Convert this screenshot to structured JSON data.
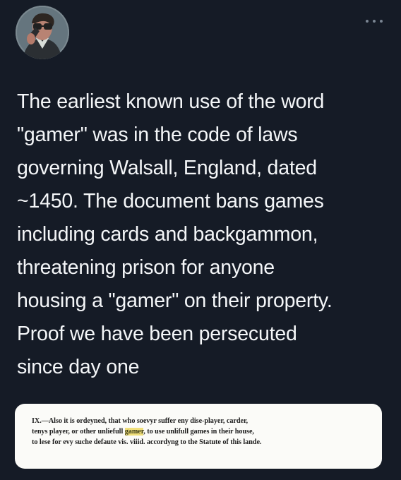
{
  "post": {
    "text": "The earliest known use of the word\n\"gamer\" was in the code of laws\ngoverning Walsall, England, dated\n~1450. The document bans games\nincluding cards and backgammon,\nthreatening prison for anyone\nhousing a \"gamer\" on their property.\nProof we have been persecuted\nsince day one",
    "more_icon": "more-horizontal-icon",
    "avatar_icon": "avatar-photo"
  },
  "document_excerpt": {
    "before_highlight": "IX.—Also it is ordeyned, that who soevyr suffer eny dise-player, carder,\ntenys player, or other unliefull ",
    "highlighted_word": "gamer",
    "after_highlight": ", to use unlifull games in their house,\nto lese for evy suche defaute vis. viiid. accordyng to the Statute of this lande.",
    "highlight_color": "#f0df7a"
  },
  "colors": {
    "background": "#151b26",
    "text": "#f4f6f8",
    "document_background": "#fbfbf8",
    "document_text": "#1c1c1c"
  }
}
